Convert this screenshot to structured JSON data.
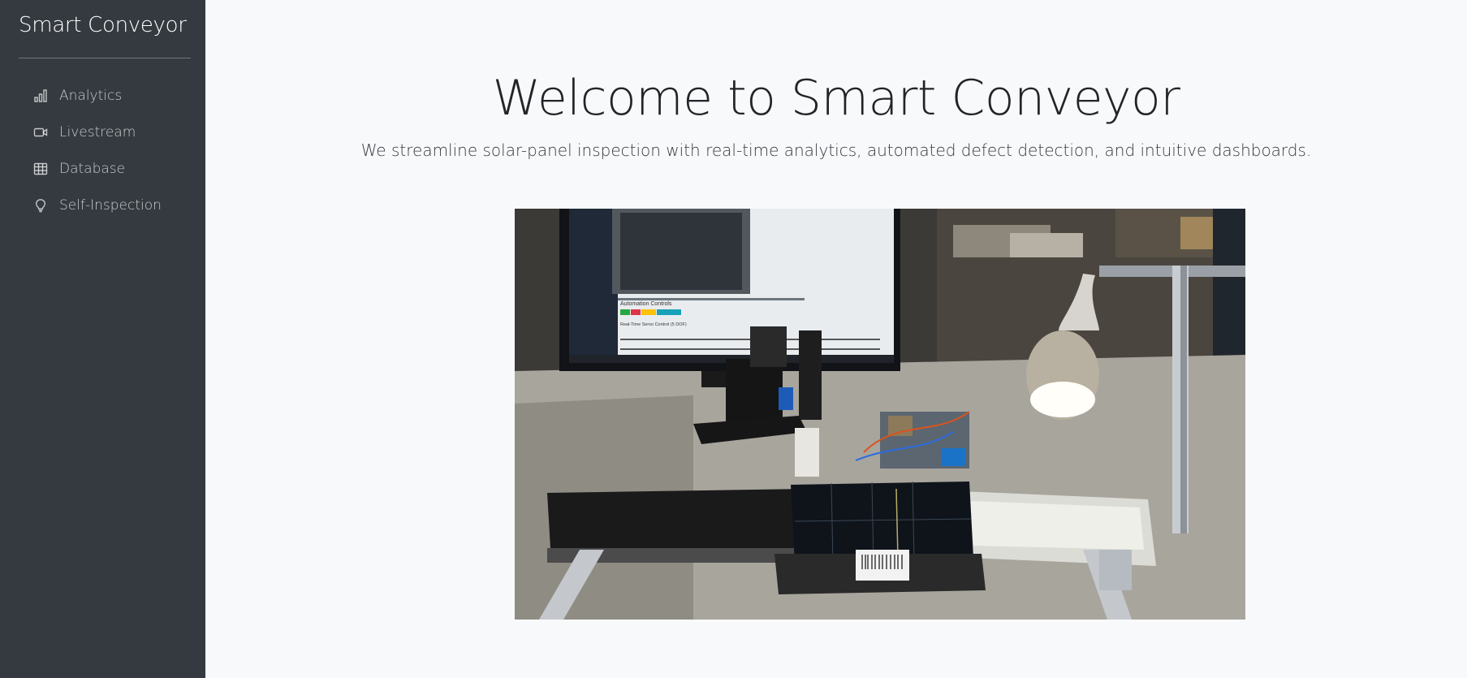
{
  "sidebar": {
    "brand": "Smart Conveyor",
    "items": [
      {
        "label": "Analytics",
        "icon": "bar-chart-icon"
      },
      {
        "label": "Livestream",
        "icon": "video-camera-icon"
      },
      {
        "label": "Database",
        "icon": "table-icon"
      },
      {
        "label": "Self-Inspection",
        "icon": "lightbulb-icon"
      }
    ]
  },
  "main": {
    "title": "Welcome to Smart Conveyor",
    "subtitle": "We streamline solar-panel inspection with real-time analytics, automated defect detection, and intuitive dashboards.",
    "video": {
      "screen_heading": "Automation Controls",
      "screen_subheading": "Real-Time Servo Control (5 DOF)"
    }
  }
}
